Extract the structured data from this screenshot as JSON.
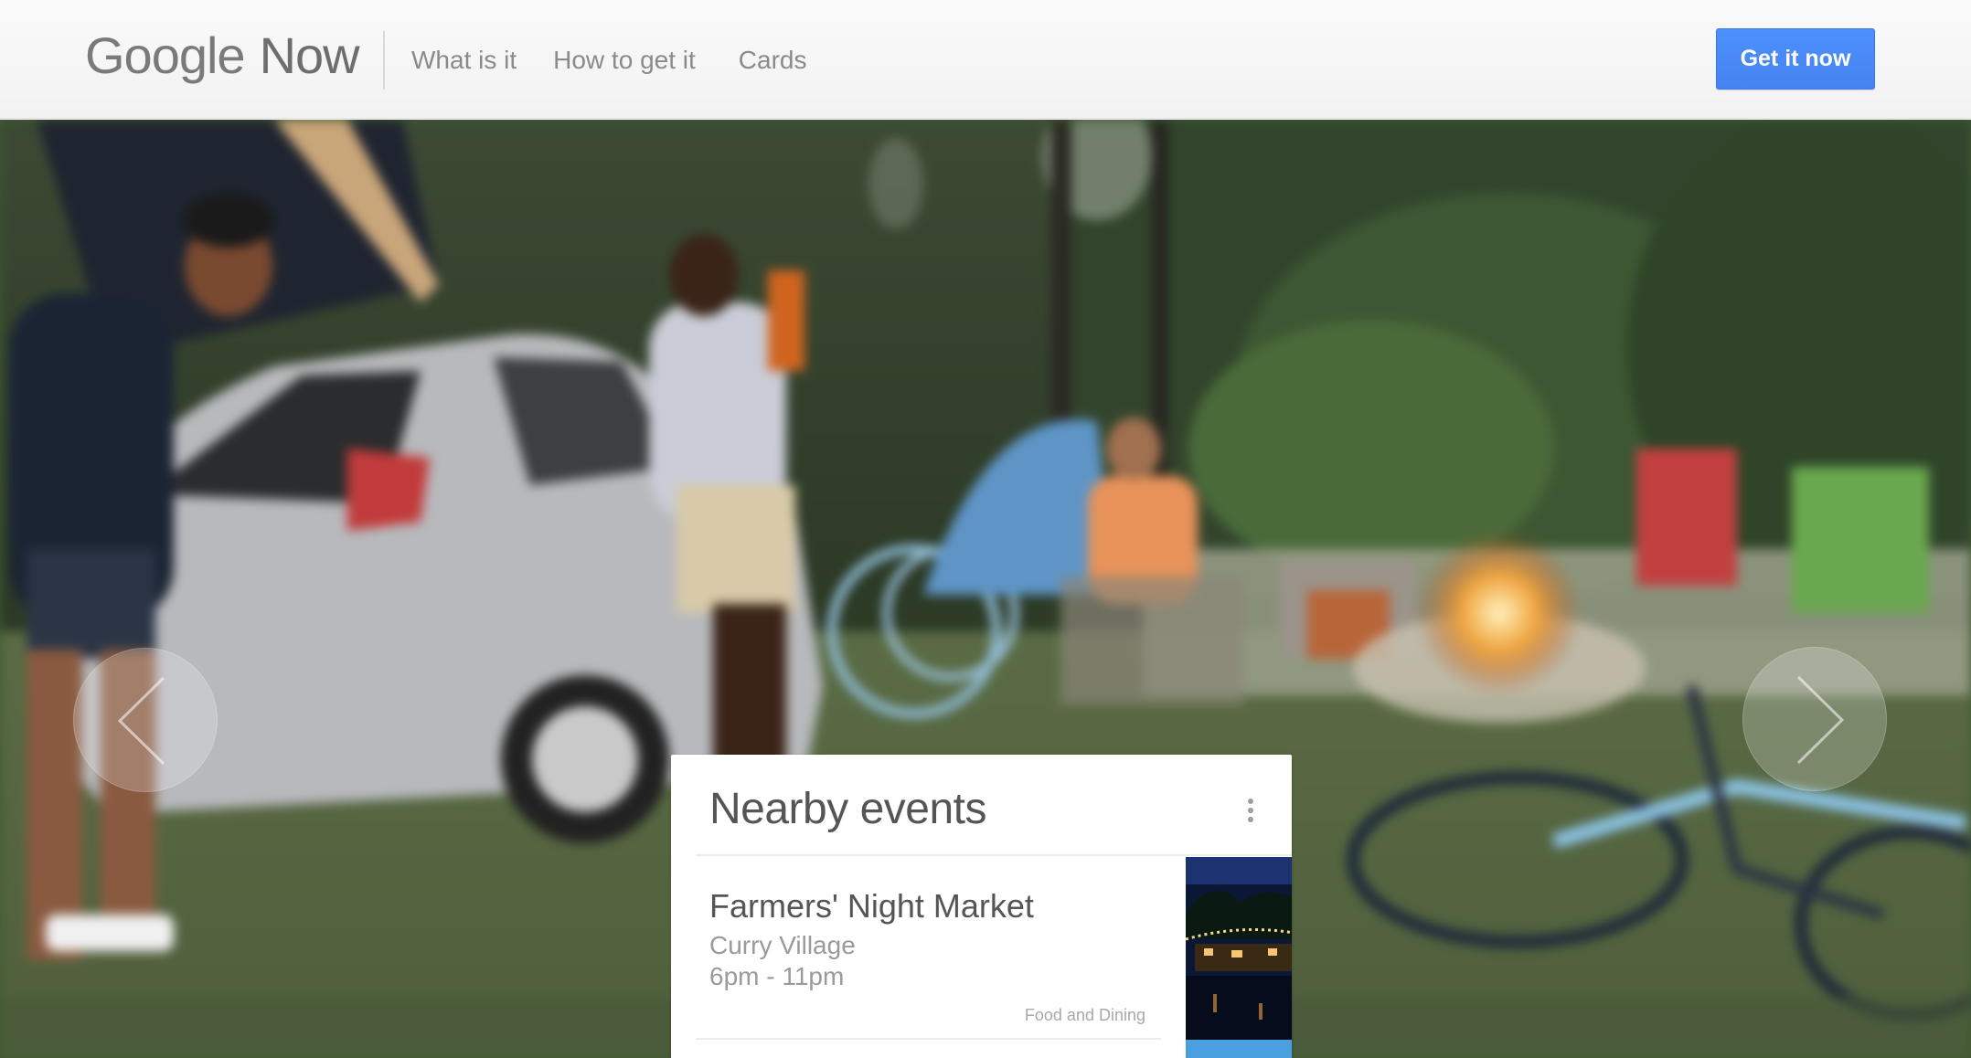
{
  "header": {
    "logo_google": "Google",
    "logo_now": "Now",
    "nav": [
      {
        "label": "What is it"
      },
      {
        "label": "How to get it"
      },
      {
        "label": "Cards"
      }
    ],
    "cta_label": "Get it now"
  },
  "colors": {
    "cta_blue": "#4d90fe",
    "header_bg": "#f5f5f5",
    "nav_text": "#8a8a8a",
    "card_title": "#555555"
  },
  "card": {
    "title": "Nearby events",
    "event": {
      "name": "Farmers' Night Market",
      "venue": "Curry Village",
      "time": "6pm - 11pm",
      "category": "Food and Dining"
    }
  },
  "icons": {
    "prev": "chevron-left-icon",
    "next": "chevron-right-icon",
    "menu": "more-vert-icon"
  }
}
